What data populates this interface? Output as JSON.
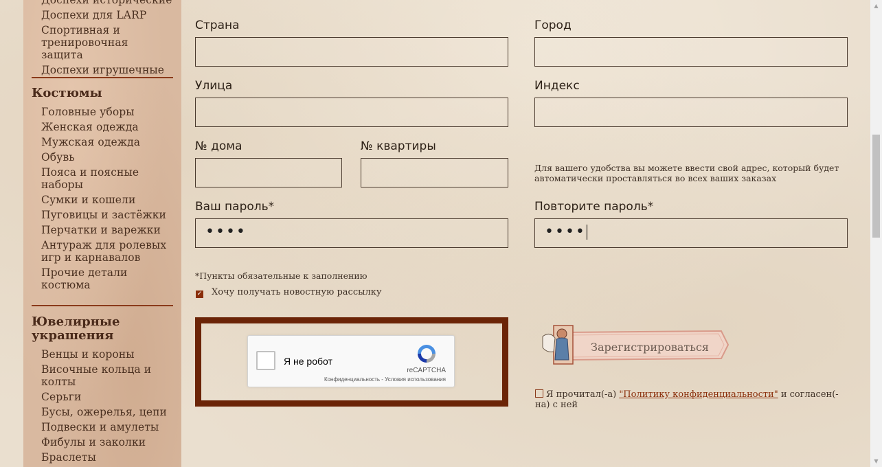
{
  "sidebar": {
    "armor_items": [
      "Доспехи исторические",
      "Доспехи для LARP",
      "Спортивная и тренировочная защита",
      "Доспехи игрушечные"
    ],
    "costumes": {
      "heading": "Костюмы",
      "items": [
        "Головные уборы",
        "Женская одежда",
        "Мужская одежда",
        "Обувь",
        "Пояса и поясные наборы",
        "Сумки и кошели",
        "Пуговицы и застёжки",
        "Перчатки и варежки",
        "Антураж для ролевых игр и карнавалов",
        "Прочие детали костюма"
      ]
    },
    "jewelry": {
      "heading": "Ювелирные украшения",
      "items": [
        "Венцы и короны",
        "Височные кольца и колты",
        "Серьги",
        "Бусы, ожерелья, цепи",
        "Подвески и амулеты",
        "Фибулы и заколки",
        "Браслеты"
      ]
    }
  },
  "form": {
    "country_label": "Страна",
    "city_label": "Город",
    "street_label": "Улица",
    "index_label": "Индекс",
    "house_label": "№ дома",
    "apartment_label": "№ квартиры",
    "address_note": "Для вашего удобства вы можете ввести свой адрес, который будет автоматически проставляться во всех ваших заказах",
    "password_label": "Ваш пароль*",
    "password_value": "••••",
    "repeat_password_label": "Повторите пароль*",
    "repeat_password_value": "••••",
    "required_note": "*Пункты обязательные к заполнению",
    "newsletter_label": "Хочу получать новостную рассылку",
    "newsletter_checked": true
  },
  "recaptcha": {
    "label": "Я не робот",
    "brand": "reCAPTCHA",
    "links": "Конфиденциальность - Условия использования"
  },
  "register_button": "Зарегистрироваться",
  "policy": {
    "prefix": "Я прочитал(-а) ",
    "link": "\"Политику конфиденциальности\"",
    "suffix": " и согласен(-на) с ней"
  },
  "colors": {
    "accent": "#6b2407",
    "sidebar_bg": "#d9b9a0",
    "page_bg": "#eadfcf"
  }
}
